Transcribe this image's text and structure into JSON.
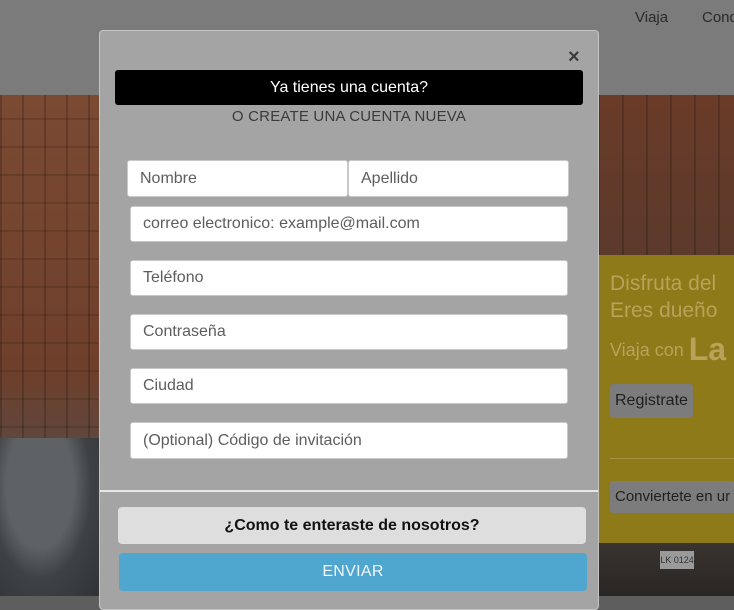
{
  "nav": {
    "items": [
      "Viaja",
      "Cond"
    ]
  },
  "promo": {
    "line1": "Disfruta del",
    "line2": "Eres dueño",
    "line3": "Viaja con",
    "line3_brand": "La",
    "register_button": "Registrate",
    "convert_button": "Conviertete en ur",
    "plate_text": "LK 0124"
  },
  "modal": {
    "close_label": "×",
    "login_prompt": "Ya tienes una cuenta?",
    "create_account": "O CREATE UNA CUENTA NUEVA",
    "fields": {
      "first_name": "Nombre",
      "last_name": "Apellido",
      "email": "correo electronico: example@mail.com",
      "phone": "Teléfono",
      "password": "Contraseña",
      "city": "Ciudad",
      "invite_code": "(Optional) Código de invitación"
    },
    "how_heard_button": "¿Como te enteraste de nosotros?",
    "submit_button": "ENVIAR"
  }
}
